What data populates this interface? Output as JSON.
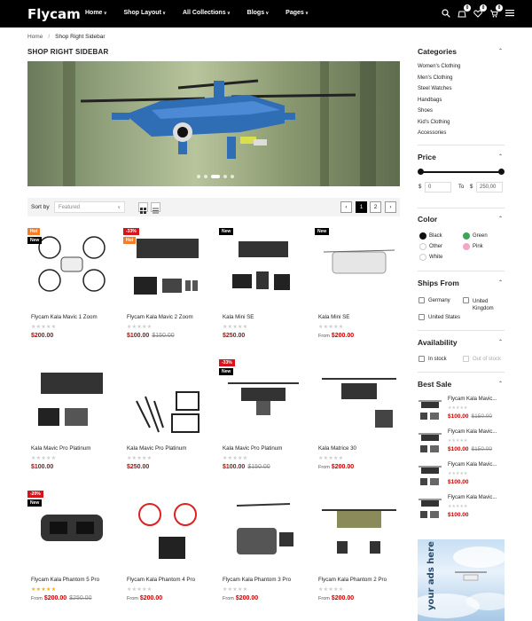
{
  "header": {
    "logo": "Flycam",
    "nav": [
      "Home",
      "Shop Layout",
      "All Collections",
      "Blogs",
      "Pages"
    ],
    "badges": {
      "account": "0",
      "wishlist": "0",
      "cart": "0"
    }
  },
  "breadcrumb": {
    "home": "Home",
    "sep": "/",
    "current": "Shop Right Sidebar"
  },
  "page_title": "SHOP RIGHT SIDEBAR",
  "toolbar": {
    "sort_label": "Sort by",
    "sort_value": "Featured",
    "pages": [
      "1",
      "2"
    ],
    "prev": "‹",
    "next": "›"
  },
  "products": [
    {
      "name": "Flycam Kala Mavic 1 Zoom",
      "tags": [
        {
          "t": "Hot",
          "c": "hot"
        },
        {
          "t": "New",
          "c": "new"
        }
      ],
      "from": "",
      "price": "$200.00",
      "old": "",
      "stars": "★★★★★",
      "full": false
    },
    {
      "name": "Flycam Kala Mavic 2 Zoom",
      "tags": [
        {
          "t": "-33%",
          "c": "sale"
        },
        {
          "t": "Hot",
          "c": "hot"
        }
      ],
      "from": "",
      "price": "$100.00",
      "old": "$150.00",
      "stars": "★★★★★",
      "full": false
    },
    {
      "name": "Kala Mini SE",
      "tags": [
        {
          "t": "New",
          "c": "new"
        }
      ],
      "from": "",
      "price": "$250.00",
      "old": "",
      "stars": "★★★★★",
      "full": false
    },
    {
      "name": "Kala Mini SE",
      "tags": [
        {
          "t": "New",
          "c": "new"
        }
      ],
      "from": "From",
      "price": "$200.00",
      "old": "",
      "stars": "★★★★★",
      "full": false
    },
    {
      "name": "Kala Mavic Pro Platinum",
      "tags": [],
      "from": "",
      "price": "$100.00",
      "old": "",
      "stars": "★★★★★",
      "full": false
    },
    {
      "name": "Kala Mavic Pro Platinum",
      "tags": [],
      "from": "",
      "price": "$250.00",
      "old": "",
      "stars": "★★★★★",
      "full": false
    },
    {
      "name": "Kala Mavic Pro Platinum",
      "tags": [
        {
          "t": "-33%",
          "c": "sale"
        },
        {
          "t": "New",
          "c": "new"
        }
      ],
      "from": "",
      "price": "$100.00",
      "old": "$150.00",
      "stars": "★★★★★",
      "full": false
    },
    {
      "name": "Kala Matrice 30",
      "tags": [],
      "from": "From",
      "price": "$200.00",
      "old": "",
      "stars": "★★★★★",
      "full": false
    },
    {
      "name": "Flycam Kala Phantom 5 Pro",
      "tags": [
        {
          "t": "-20%",
          "c": "sale"
        },
        {
          "t": "New",
          "c": "new"
        }
      ],
      "from": "From",
      "price": "$200.00",
      "old": "$250.00",
      "stars": "★★★★★",
      "full": true
    },
    {
      "name": "Flycam Kala Phantom 4 Pro",
      "tags": [],
      "from": "From",
      "price": "$200.00",
      "old": "",
      "stars": "★★★★★",
      "full": false
    },
    {
      "name": "Flycam Kala Phantom 3 Pro",
      "tags": [],
      "from": "From",
      "price": "$200.00",
      "old": "",
      "stars": "★★★★★",
      "full": false
    },
    {
      "name": "Flycam Kala Phantom 2 Pro",
      "tags": [],
      "from": "From",
      "price": "$200.00",
      "old": "",
      "stars": "★★★★★",
      "full": false
    }
  ],
  "sidebar": {
    "categories": {
      "title": "Categories",
      "items": [
        "Women's Clothing",
        "Men's Clothing",
        "Steel Watches",
        "Handbags",
        "Shoes",
        "Kid's Clothing",
        "Accessories"
      ]
    },
    "price": {
      "title": "Price",
      "currency": "$",
      "min": "0",
      "to": "To",
      "max": "250,00"
    },
    "color": {
      "title": "Color",
      "items": [
        {
          "name": "Black",
          "hex": "#111111"
        },
        {
          "name": "Green",
          "hex": "#3aa757"
        },
        {
          "name": "Other",
          "hex": "#ffffff"
        },
        {
          "name": "Pink",
          "hex": "#f3a6c6"
        },
        {
          "name": "White",
          "hex": "#ffffff"
        }
      ]
    },
    "ships": {
      "title": "Ships From",
      "items": [
        "Germany",
        "United Kingdom",
        "United States"
      ]
    },
    "availability": {
      "title": "Availability",
      "items": [
        "In stock",
        "Out of stock"
      ]
    },
    "best": {
      "title": "Best Sale",
      "items": [
        {
          "name": "Flycam Kala Mavic...",
          "price": "$100.00",
          "old": "$150.00"
        },
        {
          "name": "Flycam Kala Mavic...",
          "price": "$100.00",
          "old": "$150.00"
        },
        {
          "name": "Flycam Kala Mavic...",
          "price": "$100.00",
          "old": ""
        },
        {
          "name": "Flycam Kala Mavic...",
          "price": "$100.00",
          "old": ""
        }
      ],
      "stars": "★★★★★"
    },
    "ads": "your ads here"
  }
}
